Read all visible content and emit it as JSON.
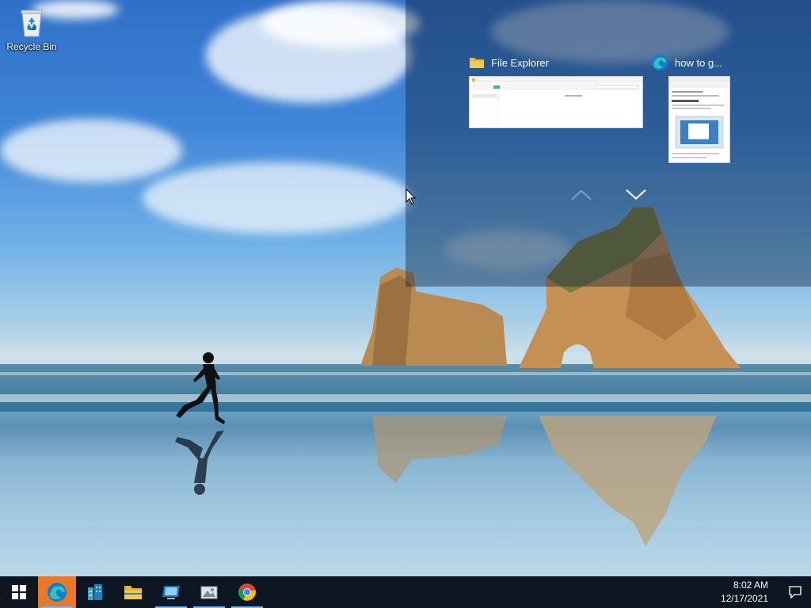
{
  "desktop": {
    "icons": [
      {
        "label": "Recycle Bin",
        "icon": "recycle-bin-icon"
      }
    ]
  },
  "task_view": {
    "windows": [
      {
        "title": "File Explorer",
        "icon": "folder-icon"
      },
      {
        "title": "how to g...",
        "icon": "edge-icon"
      }
    ],
    "explorer_thumb_text": "File Explorer",
    "scroll_up_icon": "chevron-up-icon",
    "scroll_down_icon": "chevron-down-icon"
  },
  "taskbar": {
    "start_icon": "windows-logo-icon",
    "apps": [
      {
        "name": "Microsoft Edge",
        "icon": "edge-icon",
        "active": true
      },
      {
        "name": "Server Manager",
        "icon": "server-manager-icon",
        "active": false
      },
      {
        "name": "File Explorer",
        "icon": "folder-icon",
        "active": false
      },
      {
        "name": "Remote Desktop",
        "icon": "remote-desktop-icon",
        "active": false
      },
      {
        "name": "Image Viewer",
        "icon": "image-viewer-icon",
        "active": false
      },
      {
        "name": "Google Chrome",
        "icon": "chrome-icon",
        "active": false
      }
    ],
    "clock": {
      "time": "8:02 AM",
      "date": "12/17/2021"
    },
    "notification_icon": "action-center-icon"
  },
  "colors": {
    "taskbar_bg": "#0e1621",
    "active_app_bg": "#e8782a",
    "running_indicator": "#76b9ed"
  }
}
